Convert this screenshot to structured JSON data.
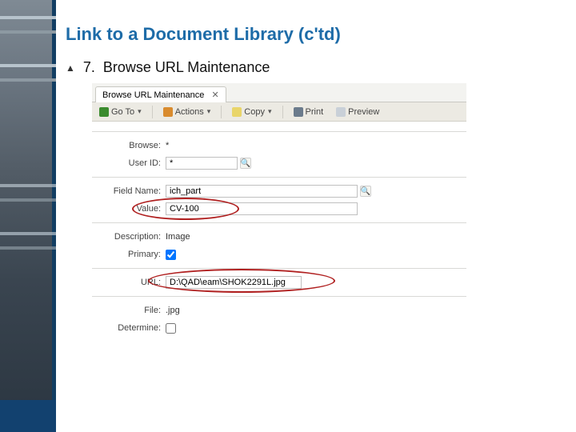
{
  "slide": {
    "title": "Link to a Document Library (c'td)",
    "step_number": "7.",
    "step_text": "Browse URL Maintenance"
  },
  "tab": {
    "title": "Browse URL Maintenance"
  },
  "toolbar": {
    "goto": "Go To",
    "actions": "Actions",
    "copy": "Copy",
    "print": "Print",
    "preview": "Preview"
  },
  "form": {
    "browse": {
      "label": "Browse:",
      "value": "*"
    },
    "user": {
      "label": "User ID:",
      "value": "*"
    },
    "field": {
      "label": "Field Name:",
      "value": "ich_part"
    },
    "value": {
      "label": "Value:",
      "value": "CV-100"
    },
    "desc": {
      "label": "Description:",
      "value": "Image"
    },
    "primary": {
      "label": "Primary:"
    },
    "url": {
      "label": "URL:",
      "value": "D:\\QAD\\eam\\SHOK2291L.jpg"
    },
    "file": {
      "label": "File:",
      "value": ".jpg"
    },
    "determine": {
      "label": "Determine:"
    }
  }
}
